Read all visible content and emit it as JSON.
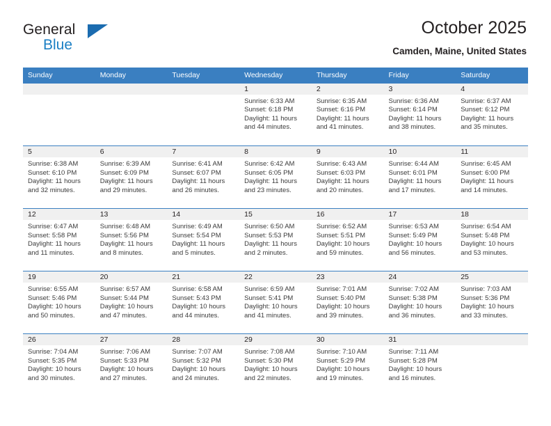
{
  "brand": {
    "name_top": "General",
    "name_bottom": "Blue",
    "accent_color": "#1b7fc4",
    "triangle_color": "#1b6cb0"
  },
  "header": {
    "title": "October 2025",
    "subtitle": "Camden, Maine, United States"
  },
  "calendar": {
    "header_bg": "#3a7fc1",
    "weekdays": [
      "Sunday",
      "Monday",
      "Tuesday",
      "Wednesday",
      "Thursday",
      "Friday",
      "Saturday"
    ],
    "labels": {
      "sunrise": "Sunrise:",
      "sunset": "Sunset:",
      "daylight": "Daylight:"
    },
    "weeks": [
      [
        {
          "day": ""
        },
        {
          "day": ""
        },
        {
          "day": ""
        },
        {
          "day": "1",
          "sunrise": "Sunrise: 6:33 AM",
          "sunset": "Sunset: 6:18 PM",
          "daylight1": "Daylight: 11 hours",
          "daylight2": "and 44 minutes."
        },
        {
          "day": "2",
          "sunrise": "Sunrise: 6:35 AM",
          "sunset": "Sunset: 6:16 PM",
          "daylight1": "Daylight: 11 hours",
          "daylight2": "and 41 minutes."
        },
        {
          "day": "3",
          "sunrise": "Sunrise: 6:36 AM",
          "sunset": "Sunset: 6:14 PM",
          "daylight1": "Daylight: 11 hours",
          "daylight2": "and 38 minutes."
        },
        {
          "day": "4",
          "sunrise": "Sunrise: 6:37 AM",
          "sunset": "Sunset: 6:12 PM",
          "daylight1": "Daylight: 11 hours",
          "daylight2": "and 35 minutes."
        }
      ],
      [
        {
          "day": "5",
          "sunrise": "Sunrise: 6:38 AM",
          "sunset": "Sunset: 6:10 PM",
          "daylight1": "Daylight: 11 hours",
          "daylight2": "and 32 minutes."
        },
        {
          "day": "6",
          "sunrise": "Sunrise: 6:39 AM",
          "sunset": "Sunset: 6:09 PM",
          "daylight1": "Daylight: 11 hours",
          "daylight2": "and 29 minutes."
        },
        {
          "day": "7",
          "sunrise": "Sunrise: 6:41 AM",
          "sunset": "Sunset: 6:07 PM",
          "daylight1": "Daylight: 11 hours",
          "daylight2": "and 26 minutes."
        },
        {
          "day": "8",
          "sunrise": "Sunrise: 6:42 AM",
          "sunset": "Sunset: 6:05 PM",
          "daylight1": "Daylight: 11 hours",
          "daylight2": "and 23 minutes."
        },
        {
          "day": "9",
          "sunrise": "Sunrise: 6:43 AM",
          "sunset": "Sunset: 6:03 PM",
          "daylight1": "Daylight: 11 hours",
          "daylight2": "and 20 minutes."
        },
        {
          "day": "10",
          "sunrise": "Sunrise: 6:44 AM",
          "sunset": "Sunset: 6:01 PM",
          "daylight1": "Daylight: 11 hours",
          "daylight2": "and 17 minutes."
        },
        {
          "day": "11",
          "sunrise": "Sunrise: 6:45 AM",
          "sunset": "Sunset: 6:00 PM",
          "daylight1": "Daylight: 11 hours",
          "daylight2": "and 14 minutes."
        }
      ],
      [
        {
          "day": "12",
          "sunrise": "Sunrise: 6:47 AM",
          "sunset": "Sunset: 5:58 PM",
          "daylight1": "Daylight: 11 hours",
          "daylight2": "and 11 minutes."
        },
        {
          "day": "13",
          "sunrise": "Sunrise: 6:48 AM",
          "sunset": "Sunset: 5:56 PM",
          "daylight1": "Daylight: 11 hours",
          "daylight2": "and 8 minutes."
        },
        {
          "day": "14",
          "sunrise": "Sunrise: 6:49 AM",
          "sunset": "Sunset: 5:54 PM",
          "daylight1": "Daylight: 11 hours",
          "daylight2": "and 5 minutes."
        },
        {
          "day": "15",
          "sunrise": "Sunrise: 6:50 AM",
          "sunset": "Sunset: 5:53 PM",
          "daylight1": "Daylight: 11 hours",
          "daylight2": "and 2 minutes."
        },
        {
          "day": "16",
          "sunrise": "Sunrise: 6:52 AM",
          "sunset": "Sunset: 5:51 PM",
          "daylight1": "Daylight: 10 hours",
          "daylight2": "and 59 minutes."
        },
        {
          "day": "17",
          "sunrise": "Sunrise: 6:53 AM",
          "sunset": "Sunset: 5:49 PM",
          "daylight1": "Daylight: 10 hours",
          "daylight2": "and 56 minutes."
        },
        {
          "day": "18",
          "sunrise": "Sunrise: 6:54 AM",
          "sunset": "Sunset: 5:48 PM",
          "daylight1": "Daylight: 10 hours",
          "daylight2": "and 53 minutes."
        }
      ],
      [
        {
          "day": "19",
          "sunrise": "Sunrise: 6:55 AM",
          "sunset": "Sunset: 5:46 PM",
          "daylight1": "Daylight: 10 hours",
          "daylight2": "and 50 minutes."
        },
        {
          "day": "20",
          "sunrise": "Sunrise: 6:57 AM",
          "sunset": "Sunset: 5:44 PM",
          "daylight1": "Daylight: 10 hours",
          "daylight2": "and 47 minutes."
        },
        {
          "day": "21",
          "sunrise": "Sunrise: 6:58 AM",
          "sunset": "Sunset: 5:43 PM",
          "daylight1": "Daylight: 10 hours",
          "daylight2": "and 44 minutes."
        },
        {
          "day": "22",
          "sunrise": "Sunrise: 6:59 AM",
          "sunset": "Sunset: 5:41 PM",
          "daylight1": "Daylight: 10 hours",
          "daylight2": "and 41 minutes."
        },
        {
          "day": "23",
          "sunrise": "Sunrise: 7:01 AM",
          "sunset": "Sunset: 5:40 PM",
          "daylight1": "Daylight: 10 hours",
          "daylight2": "and 39 minutes."
        },
        {
          "day": "24",
          "sunrise": "Sunrise: 7:02 AM",
          "sunset": "Sunset: 5:38 PM",
          "daylight1": "Daylight: 10 hours",
          "daylight2": "and 36 minutes."
        },
        {
          "day": "25",
          "sunrise": "Sunrise: 7:03 AM",
          "sunset": "Sunset: 5:36 PM",
          "daylight1": "Daylight: 10 hours",
          "daylight2": "and 33 minutes."
        }
      ],
      [
        {
          "day": "26",
          "sunrise": "Sunrise: 7:04 AM",
          "sunset": "Sunset: 5:35 PM",
          "daylight1": "Daylight: 10 hours",
          "daylight2": "and 30 minutes."
        },
        {
          "day": "27",
          "sunrise": "Sunrise: 7:06 AM",
          "sunset": "Sunset: 5:33 PM",
          "daylight1": "Daylight: 10 hours",
          "daylight2": "and 27 minutes."
        },
        {
          "day": "28",
          "sunrise": "Sunrise: 7:07 AM",
          "sunset": "Sunset: 5:32 PM",
          "daylight1": "Daylight: 10 hours",
          "daylight2": "and 24 minutes."
        },
        {
          "day": "29",
          "sunrise": "Sunrise: 7:08 AM",
          "sunset": "Sunset: 5:30 PM",
          "daylight1": "Daylight: 10 hours",
          "daylight2": "and 22 minutes."
        },
        {
          "day": "30",
          "sunrise": "Sunrise: 7:10 AM",
          "sunset": "Sunset: 5:29 PM",
          "daylight1": "Daylight: 10 hours",
          "daylight2": "and 19 minutes."
        },
        {
          "day": "31",
          "sunrise": "Sunrise: 7:11 AM",
          "sunset": "Sunset: 5:28 PM",
          "daylight1": "Daylight: 10 hours",
          "daylight2": "and 16 minutes."
        },
        {
          "day": ""
        }
      ]
    ]
  }
}
